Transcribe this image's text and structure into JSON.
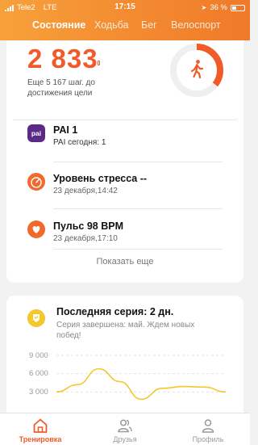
{
  "status": {
    "carrier": "Tele2",
    "network": "LTE",
    "time": "17:15",
    "battery": "36 %"
  },
  "tabs": [
    {
      "label": "Состояние",
      "active": true
    },
    {
      "label": "Ходьба"
    },
    {
      "label": "Бег"
    },
    {
      "label": "Велоспорт"
    }
  ],
  "steps": {
    "value": "2 833",
    "remaining_text": "Еще 5 167 шаг. до достижения цели",
    "progress": 0.354
  },
  "items": [
    {
      "title": "PAI 1",
      "subtitle": "PAI сегодня: 1",
      "icon": "pai"
    },
    {
      "title": "Уровень стресса --",
      "subtitle": "23 декабря,14:42",
      "icon": "gauge"
    },
    {
      "title": "Пульс 98 BPM",
      "subtitle": "23 декабря,17:10",
      "icon": "heart"
    }
  ],
  "show_more": "Показать еще",
  "streak": {
    "title": "Последняя серия: 2 дн.",
    "subtitle": "Серия завершена: май. Ждем новых побед!"
  },
  "chart_data": {
    "type": "line",
    "y_ticks": [
      "9 000",
      "6 000",
      "3 000"
    ],
    "ylim": [
      0,
      9000
    ],
    "values": [
      3000,
      4200,
      6800,
      4700,
      1800,
      3600,
      3900,
      3800,
      3000
    ],
    "color": "#f4c72a"
  },
  "nav": [
    {
      "label": "Тренировка",
      "active": true
    },
    {
      "label": "Друзья"
    },
    {
      "label": "Профиль"
    }
  ],
  "colors": {
    "accent": "#f15a29",
    "header": "#f38a30"
  }
}
